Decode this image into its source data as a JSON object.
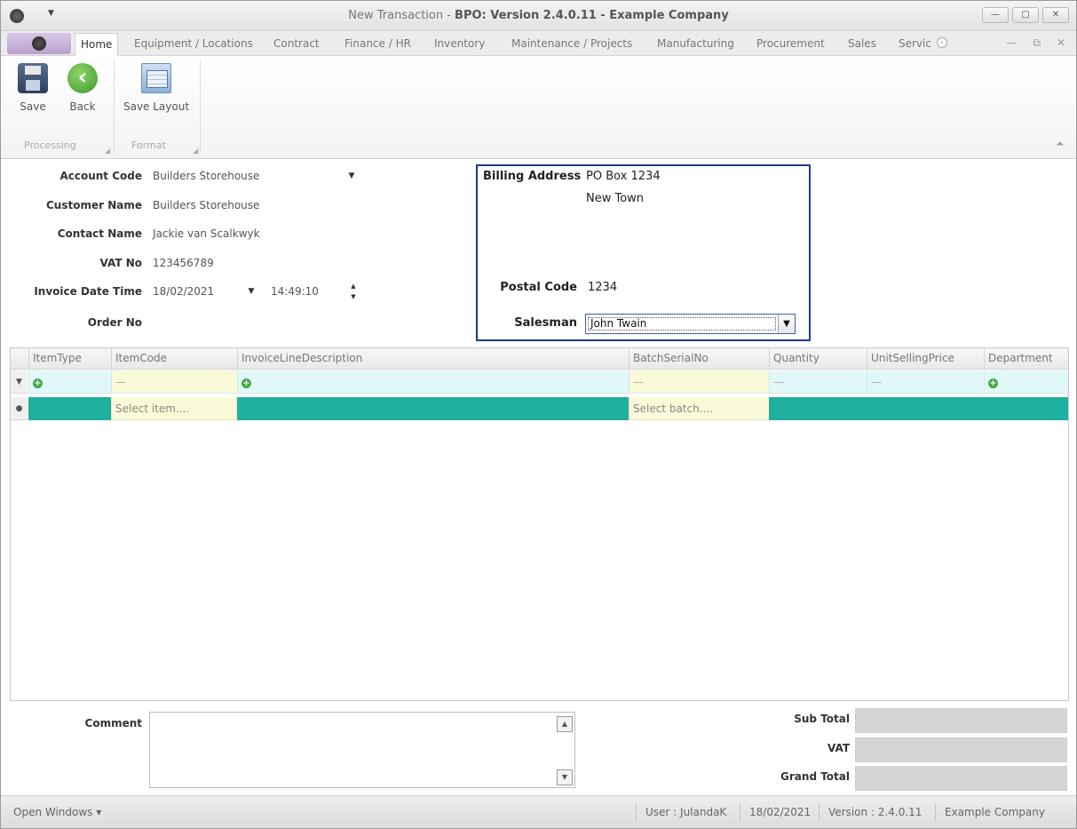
{
  "window": {
    "title_prefix": "New Transaction - ",
    "title_main": "BPO: Version 2.4.0.11 - Example Company",
    "qa_arrow": "▼",
    "minimize": "—",
    "maximize": "▢",
    "close": "✕"
  },
  "ribbon": {
    "tabs": [
      {
        "label": "Home"
      },
      {
        "label": "Equipment / Locations"
      },
      {
        "label": "Contract"
      },
      {
        "label": "Finance / HR"
      },
      {
        "label": "Inventory"
      },
      {
        "label": "Maintenance / Projects"
      },
      {
        "label": "Manufacturing"
      },
      {
        "label": "Procurement"
      },
      {
        "label": "Sales"
      },
      {
        "label": "Servic"
      }
    ],
    "more_tabs": "›",
    "mdi_minimize": "—",
    "mdi_restore": "⧉",
    "mdi_close": "✕",
    "buttons": {
      "save": "Save",
      "back": "Back",
      "save_layout": "Save Layout"
    },
    "groups": {
      "processing": "Processing",
      "format": "Format"
    },
    "group_launcher": "◢",
    "collapse": "⏶"
  },
  "form": {
    "account_code_label": "Account Code",
    "account_code": "Builders Storehouse",
    "customer_name_label": "Customer Name",
    "customer_name": "Builders Storehouse",
    "contact_name_label": "Contact Name",
    "contact_name": "Jackie van Scalkwyk",
    "vat_no_label": "VAT No",
    "vat_no": "123456789",
    "invoice_date_label": "Invoice Date Time",
    "invoice_date": "18/02/2021",
    "invoice_time": "14:49:10",
    "order_no_label": "Order No",
    "dropdown_arrow": "▼",
    "spin_up": "▲",
    "spin_down": "▼"
  },
  "billing": {
    "billing_address_label": "Billing Address",
    "address_line1": "PO Box 1234",
    "address_line2": "New Town",
    "postal_code_label": "Postal Code",
    "postal_code": "1234",
    "salesman_label": "Salesman",
    "salesman": "John Twain",
    "salesman_arrow": "▼"
  },
  "grid": {
    "columns": [
      {
        "label": "ItemType"
      },
      {
        "label": "ItemCode"
      },
      {
        "label": "InvoiceLineDescription"
      },
      {
        "label": "BatchSerialNo"
      },
      {
        "label": "Quantity"
      },
      {
        "label": "UnitSellingPrice"
      },
      {
        "label": "Department"
      }
    ],
    "filter_indicator": "▼",
    "new_row_indicator": "●",
    "filter_plus": "+",
    "filter_dash": "—",
    "new_row": {
      "item_code_placeholder": "Select item....",
      "batch_placeholder": "Select batch...."
    }
  },
  "footer": {
    "comment_label": "Comment",
    "scroll_up": "▲",
    "scroll_down": "▼",
    "sub_total_label": "Sub Total",
    "vat_label": "VAT",
    "grand_total_label": "Grand Total"
  },
  "statusbar": {
    "open_windows": "Open Windows ▾",
    "user": "User : JulandaK",
    "date": "18/02/2021",
    "version": "Version : 2.4.0.11",
    "company": "Example Company"
  }
}
